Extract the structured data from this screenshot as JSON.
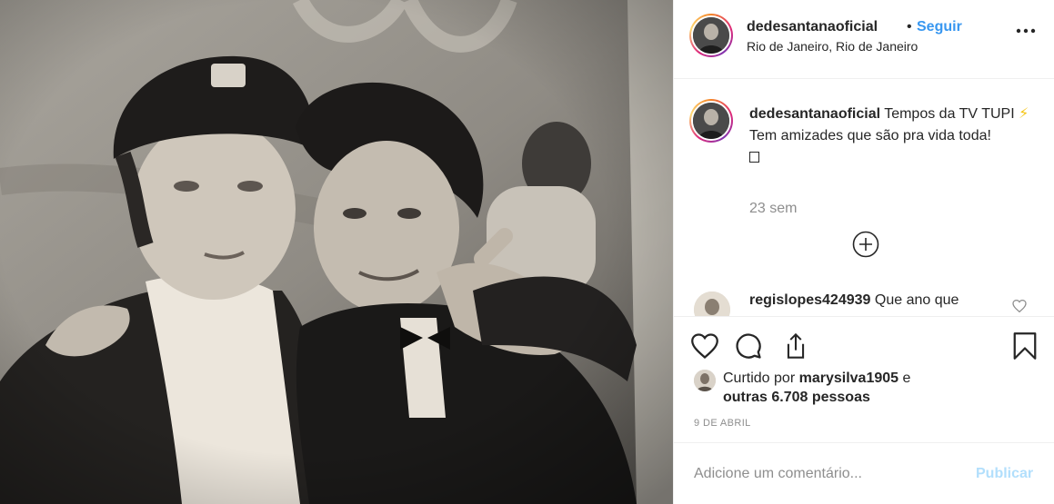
{
  "header": {
    "username": "dedesantanaoficial",
    "separator": "•",
    "follow_label": "Seguir",
    "location": "Rio de Janeiro, Rio de Janeiro",
    "more_icon": "ellipsis-icon"
  },
  "caption": {
    "username": "dedesantanaoficial",
    "text_line1": "Tempos da TV TUPI",
    "emoji": "⚡",
    "text_line2": "Tem amizades que são pra vida toda!",
    "time_ago": "23 sem"
  },
  "load_more_icon": "plus-circle-icon",
  "comments": [
    {
      "username": "regislopes424939",
      "text": "Que ano que"
    }
  ],
  "actions": {
    "like_icon": "heart-icon",
    "comment_icon": "comment-icon",
    "share_icon": "share-icon",
    "save_icon": "bookmark-icon"
  },
  "likes": {
    "prefix": "Curtido por",
    "liker": "marysilva1905",
    "connector": "e",
    "others": "outras 6.708 pessoas"
  },
  "date": "9 DE ABRIL",
  "add_comment": {
    "placeholder": "Adicione um comentário...",
    "publish_label": "Publicar"
  },
  "colors": {
    "link_blue": "#3897f0",
    "publish_disabled": "#b2dffc",
    "secondary_text": "#8e8e8e",
    "primary_text": "#262626",
    "divider": "#efefef"
  }
}
